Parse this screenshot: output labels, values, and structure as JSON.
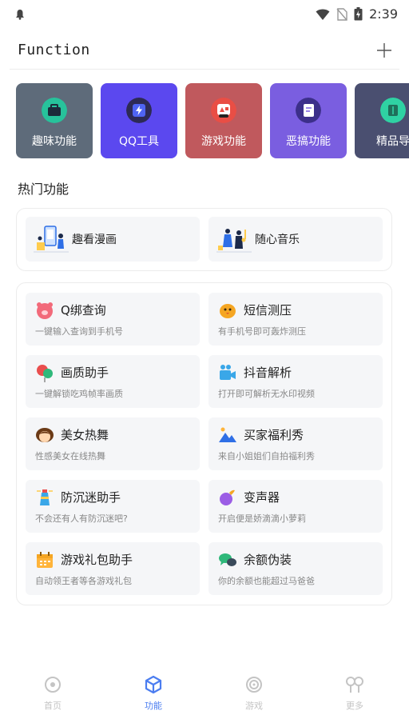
{
  "status_bar": {
    "time": "2:39",
    "icons": [
      "notification-bell-icon",
      "wifi-icon",
      "no-sim-icon",
      "battery-icon"
    ]
  },
  "header": {
    "title": "Function",
    "add_icon": "plus-icon"
  },
  "categories": [
    {
      "label": "趣味功能",
      "color": "#5e6b7a",
      "icon": "briefcase-icon"
    },
    {
      "label": "QQ工具",
      "color": "#5b48ef",
      "icon": "lightning-icon"
    },
    {
      "label": "游戏功能",
      "color": "#c0595d",
      "icon": "gamepad-icon"
    },
    {
      "label": "恶搞功能",
      "color": "#7a5ee0",
      "icon": "document-icon"
    },
    {
      "label": "精品导",
      "color": "#4a4f70",
      "icon": "book-icon"
    }
  ],
  "section_title": "热门功能",
  "hot": [
    {
      "label": "趣看漫画",
      "icon": "comic-reading-illustration"
    },
    {
      "label": "随心音乐",
      "icon": "music-illustration"
    }
  ],
  "tools": [
    {
      "title": "Q绑查询",
      "desc": "一键输入查询到手机号",
      "icon": "pig-icon"
    },
    {
      "title": "短信测压",
      "desc": "有手机号即可轰炸测压",
      "icon": "chick-icon"
    },
    {
      "title": "画质助手",
      "desc": "一键解锁吃鸡帧率画质",
      "icon": "balloon-icon"
    },
    {
      "title": "抖音解析",
      "desc": "打开即可解析无水印视频",
      "icon": "video-camera-icon"
    },
    {
      "title": "美女热舞",
      "desc": "性感美女在线热舞",
      "icon": "girl-face-icon"
    },
    {
      "title": "买家福利秀",
      "desc": "来自小姐姐们自拍福利秀",
      "icon": "mountain-picture-icon"
    },
    {
      "title": "防沉迷助手",
      "desc": "不会还有人有防沉迷吧?",
      "icon": "lighthouse-icon"
    },
    {
      "title": "变声器",
      "desc": "开启便是娇滴滴小萝莉",
      "icon": "eggplant-icon"
    },
    {
      "title": "游戏礼包助手",
      "desc": "自动领王者等各游戏礼包",
      "icon": "calendar-icon"
    },
    {
      "title": "余额伪装",
      "desc": "你的余额也能超过马爸爸",
      "icon": "chat-bubbles-icon"
    }
  ],
  "bottom_nav": [
    {
      "label": "首页",
      "icon": "home-circle-icon",
      "active": false
    },
    {
      "label": "功能",
      "icon": "cube-icon",
      "active": true
    },
    {
      "label": "游戏",
      "icon": "game-spiral-icon",
      "active": false
    },
    {
      "label": "更多",
      "icon": "more-people-icon",
      "active": false
    }
  ],
  "colors": {
    "accent": "#4b7df0",
    "card_bg": "#f5f6f8",
    "muted_text": "#888888"
  }
}
